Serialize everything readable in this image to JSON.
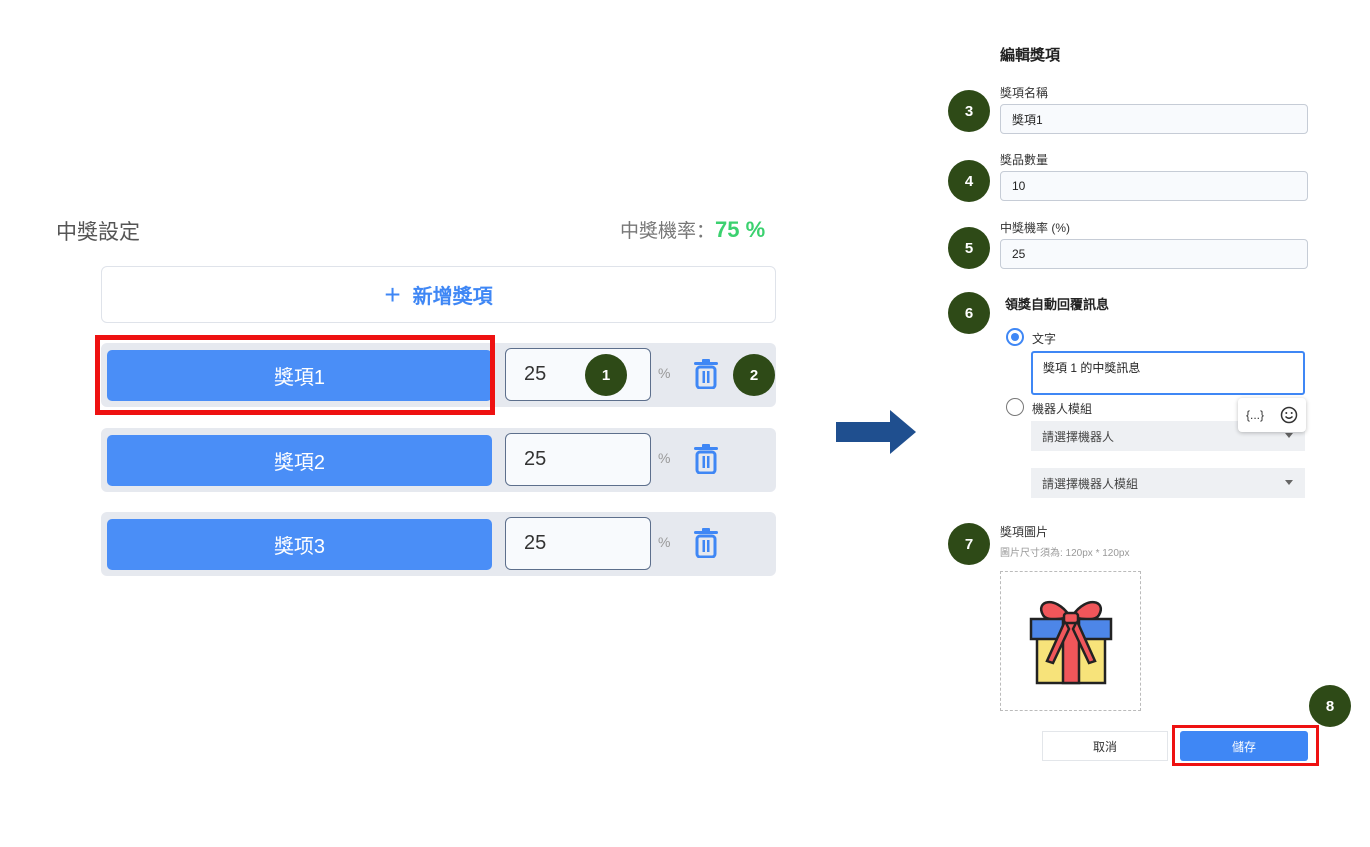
{
  "left": {
    "title": "中獎設定",
    "rate_label": "中獎機率：",
    "rate_value": "75 %",
    "add_button": {
      "icon": "plus-icon",
      "label": "新增獎項"
    },
    "prizes": [
      {
        "label": "獎項1",
        "value": "25",
        "unit": "%"
      },
      {
        "label": "獎項2",
        "value": "25",
        "unit": "%"
      },
      {
        "label": "獎项3",
        "value": "25",
        "unit": "%"
      }
    ]
  },
  "badges": [
    "1",
    "2",
    "3",
    "4",
    "5",
    "6",
    "7",
    "8"
  ],
  "edit": {
    "title": "編輯獎項",
    "name_label": "獎項名稱",
    "name_value": "獎項1",
    "qty_label": "獎品數量",
    "qty_value": "10",
    "rate_label": "中獎機率 (%)",
    "rate_value": "25",
    "reply_title": "領獎自動回覆訊息",
    "option_text": "文字",
    "message_value": "獎項 1 的中獎訊息",
    "option_bot": "機器人模組",
    "tool_var": "{...}",
    "select_bot": "請選擇機器人",
    "select_module": "請選擇機器人模組",
    "image_label": "獎項圖片",
    "image_hint": "圖片尺寸須為: 120px * 120px",
    "cancel": "取消",
    "save": "儲存"
  },
  "colors": {
    "accent": "#3f87f5",
    "prize_button": "#4a8ef7",
    "rate_green": "#3bd16f",
    "badge": "#2e4a17",
    "highlight_red": "#ee1111",
    "arrow": "#1f4f8f"
  }
}
